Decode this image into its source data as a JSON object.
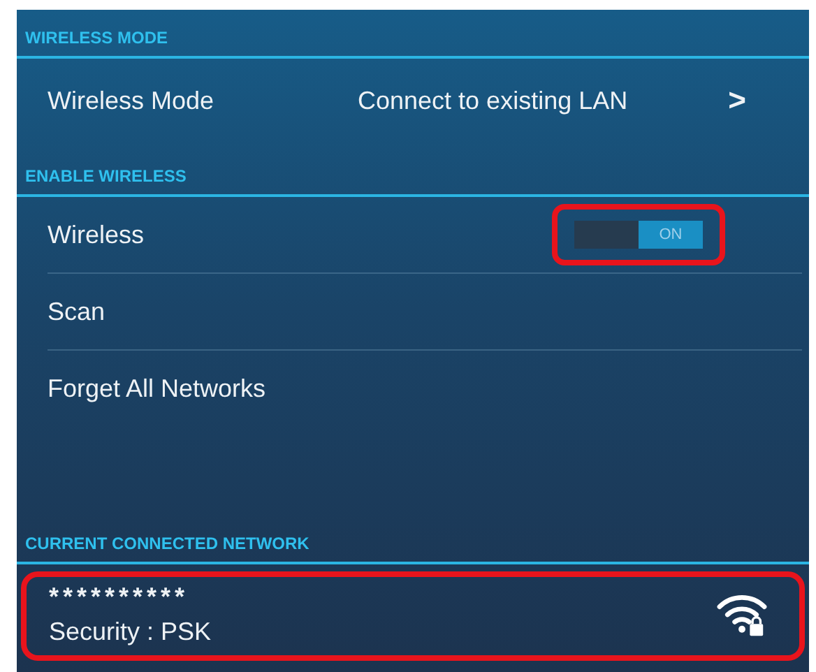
{
  "sections": [
    {
      "header": "WIRELESS MODE",
      "rows": [
        {
          "kind": "link",
          "label": "Wireless Mode",
          "value": "Connect to existing LAN",
          "chevron": ">"
        }
      ]
    },
    {
      "header": "ENABLE WIRELESS",
      "rows": [
        {
          "kind": "toggle",
          "label": "Wireless",
          "on": true,
          "toggle_text": "ON",
          "highlighted": true
        },
        {
          "kind": "plain",
          "label": "Scan"
        },
        {
          "kind": "plain",
          "label": "Forget All Networks"
        }
      ]
    },
    {
      "header": "CURRENT CONNECTED NETWORK",
      "rows": [
        {
          "kind": "network",
          "label": "**********",
          "security": "Security : PSK",
          "highlighted": true
        }
      ]
    }
  ]
}
